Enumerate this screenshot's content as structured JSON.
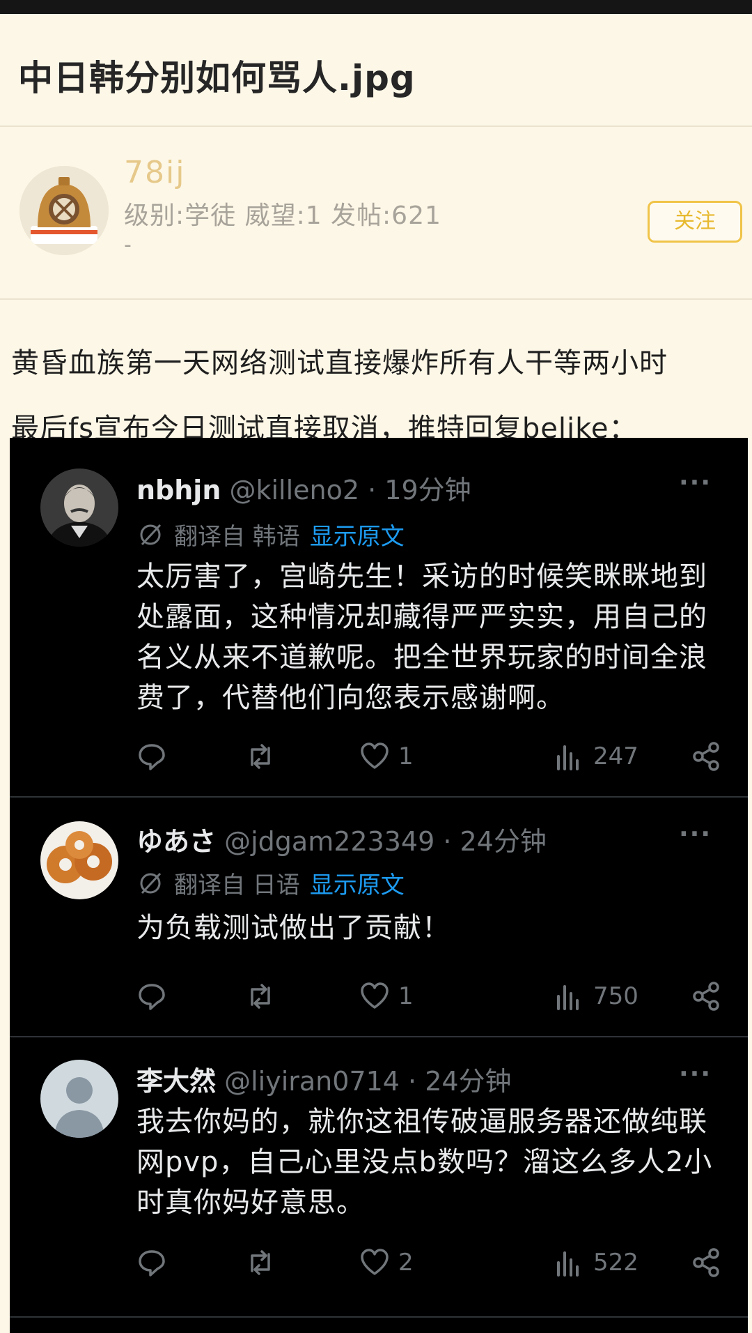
{
  "post": {
    "title": "中日韩分别如何骂人.jpg",
    "author": {
      "username": "78ij",
      "meta": "级别:学徒 威望:1 发帖:621",
      "signature": "-",
      "follow_label": "关注"
    },
    "body_lines": [
      "黄昏血族第一天网络测试直接爆炸所有人干等两小时",
      "最后fs宣布今日测试直接取消，推特回复belike："
    ]
  },
  "tweets": [
    {
      "name": "nbhjn",
      "handle": "@killeno2 · 19分钟",
      "more": "···",
      "translation": "翻译自 韩语",
      "show_original": "显示原文",
      "text_lines": [
        "太厉害了，宫崎先生！采访的时候笑眯眯地到",
        "处露面，这种情况却藏得严严实实，用自己的",
        "名义从来不道歉呢。把全世界玩家的时间全浪",
        "费了，代替他们向您表示感谢啊。"
      ],
      "likes": "1",
      "views": "247"
    },
    {
      "name": "ゆあさ",
      "handle": "@jdgam223349 · 24分钟",
      "more": "···",
      "translation": "翻译自 日语",
      "show_original": "显示原文",
      "text_lines": [
        "为负载测试做出了贡献！"
      ],
      "likes": "1",
      "views": "750"
    },
    {
      "name": "李大然",
      "handle": "@liyiran0714 · 24分钟",
      "more": "···",
      "text_lines": [
        "我去你妈的，就你这祖传破逼服务器还做纯联",
        "网pvp，自己心里没点b数吗？溜这么多人2小",
        "时真你妈好意思。"
      ],
      "likes": "2",
      "views": "522"
    }
  ],
  "colors": {
    "page_bg": "#fdf7e7",
    "username": "#e6c98a",
    "follow": "#f0c448",
    "tweet_bg": "#000000",
    "tweet_text": "#e7e9ea",
    "tweet_muted": "#71767b",
    "link": "#1d9bf0"
  }
}
